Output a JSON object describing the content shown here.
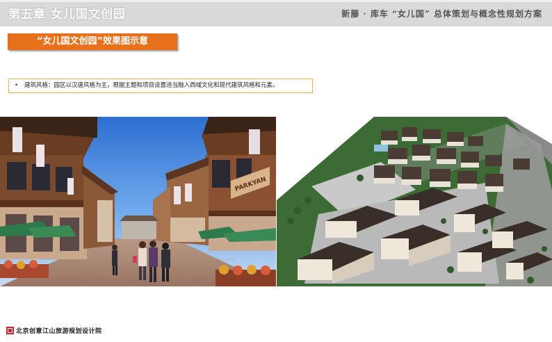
{
  "header": {
    "chapter_title": "第五章  女儿国文创园",
    "project_title": "新藤 · 库车 “女儿国” 总体策划与概念性规划方案"
  },
  "banner": {
    "title": "“女儿国文创园”效果图示意"
  },
  "note": {
    "bullet": "•",
    "text": "建筑风格：园区以汉唐风格为主，根据主题和项目设置适当融入西域文化和现代建筑风格和元素。"
  },
  "photos": {
    "street": {
      "sign": "PARKYAN"
    }
  },
  "footer": {
    "organization": "北京创意江山旅游规划设计院"
  },
  "colors": {
    "accent": "#e7701d",
    "note_border": "#e5b54a",
    "logo": "#c8282d"
  }
}
